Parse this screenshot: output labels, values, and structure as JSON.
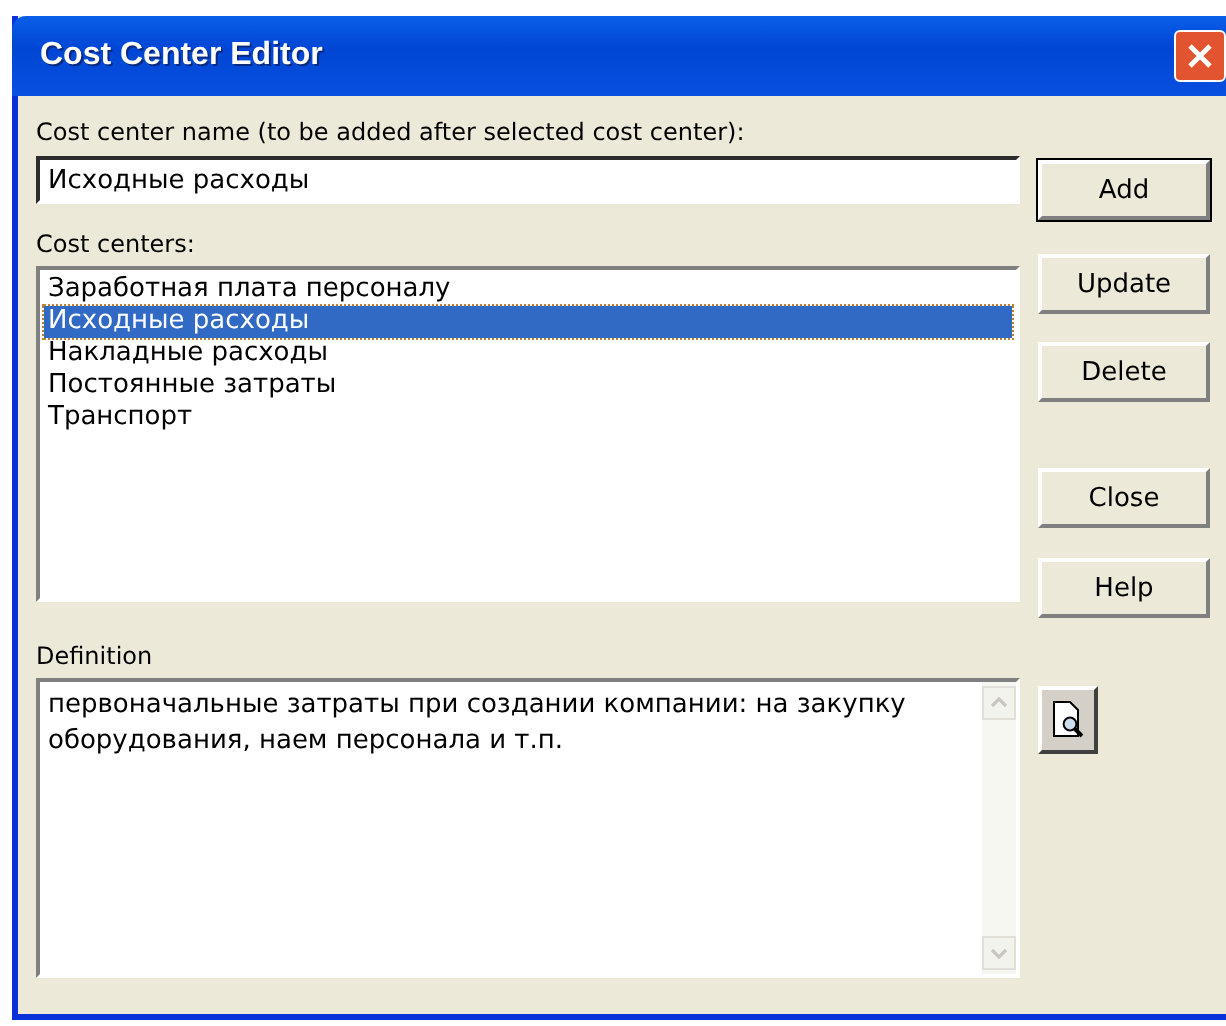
{
  "window": {
    "title": "Cost Center Editor"
  },
  "name_field": {
    "label": "Cost center name (to be added after selected cost center):",
    "value": "Исходные расходы"
  },
  "list": {
    "label": "Cost centers:",
    "items": [
      {
        "text": "Заработная плата персоналу",
        "selected": false
      },
      {
        "text": "Исходные расходы",
        "selected": true
      },
      {
        "text": "Накладные расходы",
        "selected": false
      },
      {
        "text": "Постоянные затраты",
        "selected": false
      },
      {
        "text": "Транспорт",
        "selected": false
      }
    ]
  },
  "buttons": [
    {
      "label": "Add",
      "default": true
    },
    {
      "label": "Update",
      "default": false
    },
    {
      "label": "Delete",
      "default": false
    },
    {
      "label": "Close",
      "default": false
    },
    {
      "label": "Help",
      "default": false
    }
  ],
  "definition": {
    "label": "Definition",
    "text": "первоначальные затраты при создании компании: на закупку оборудования, наем персонала и т.п."
  }
}
